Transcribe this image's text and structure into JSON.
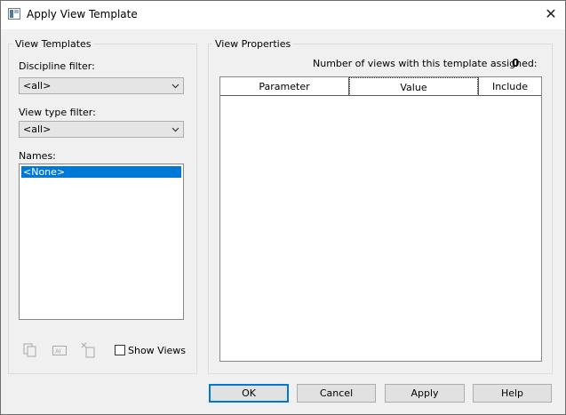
{
  "window": {
    "title": "Apply View Template",
    "close_label": "✕"
  },
  "left_group": {
    "title": "View Templates",
    "discipline_filter": {
      "label": "Discipline filter:",
      "value": "<all>"
    },
    "view_type_filter": {
      "label": "View type filter:",
      "value": "<all>"
    },
    "names": {
      "label": "Names:",
      "items": [
        "<None>"
      ],
      "selected_index": 0
    },
    "toolbar_icons": [
      "duplicate-icon",
      "rename-icon",
      "delete-icon"
    ],
    "show_views": {
      "label": "Show Views",
      "checked": false
    }
  },
  "right_group": {
    "title": "View Properties",
    "assigned_label": "Number of views with this template assigned:",
    "assigned_count": "0",
    "table": {
      "columns": [
        "Parameter",
        "Value",
        "Include"
      ],
      "rows": []
    }
  },
  "buttons": {
    "ok": "OK",
    "cancel": "Cancel",
    "apply": "Apply",
    "help": "Help"
  }
}
